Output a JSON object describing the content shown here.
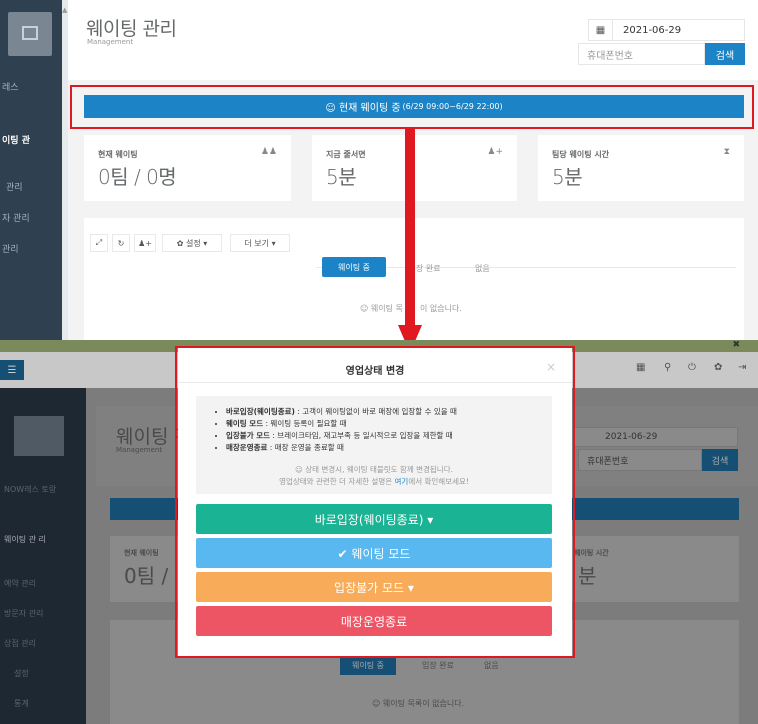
{
  "header": {
    "title": "웨이팅 관리",
    "subtitle": "Management",
    "date": "2021-06-29",
    "phone_placeholder": "휴대폰번호",
    "search_label": "검색"
  },
  "sidebar": {
    "items": [
      "NOW레스 토랑",
      "웨이팅 관리",
      "예약 관리",
      "방문자 관리",
      "상점 관리",
      "설정",
      "통계"
    ],
    "top_items": [
      "레스",
      "이팅 관",
      "관리",
      "자 관리",
      "관리"
    ]
  },
  "status_bar": {
    "label": "☺ 현재 웨이팅 중",
    "range": "(6/29 09:00~6/29 22:00)"
  },
  "stats": [
    {
      "label": "현재 웨이팅",
      "value": "0팀 / 0명",
      "icon": "group-icon"
    },
    {
      "label": "지금 줄서면",
      "value": "5분",
      "icon": "user-add-icon"
    },
    {
      "label": "팀당 웨이팅 시간",
      "value": "5분",
      "icon": "hourglass-icon"
    }
  ],
  "toolbar": {
    "settings_label": "✿ 설정 ▾",
    "more_label": "더 보기 ▾"
  },
  "tabs": [
    "웨이팅 중",
    "입장 완료",
    "없음"
  ],
  "empty_message": "☺ 웨이팅 목록이 없습니다.",
  "bottom_stats": [
    {
      "label": "현재 웨이팅",
      "value": "0팀 /"
    },
    {
      "label": "웨이팅 시간",
      "value": "분"
    }
  ],
  "bottom_tabs": [
    "웨이팅 중",
    "입장 완료",
    "없음"
  ],
  "bottom_empty": "☺ 웨이팅 목록이 없습니다.",
  "top_partial_tabs": [
    "장 완료"
  ],
  "top_partial_empty": "☺ 웨이팅 목",
  "top_partial_empty_tail": "이 없습니다.",
  "bottom_sidebar_labels": [
    "NOW레스 토랑",
    "웨이팅 관 리",
    "예약 관리",
    "방문자 관리",
    "상점 관리",
    "설정",
    "통계"
  ],
  "modal": {
    "title": "영업상태 변경",
    "close": "×",
    "bullets": [
      {
        "bold": "바로입장(웨이팅종료)",
        "text": " : 고객이 웨이팅없이 바로 매장에 입장할 수 있을 때"
      },
      {
        "bold": "웨이팅 모드",
        "text": " : 웨이팅 등록이 필요할 때"
      },
      {
        "bold": "입장불가 모드",
        "text": " : 브레이크타임, 재고부족 등 일시적으로 입장을 제한할 때"
      },
      {
        "bold": "매장운영종료",
        "text": " : 매장 운영을 종료할 때"
      }
    ],
    "note1": "☺ 상태 변경시, 웨이팅 태블릿도 함께 변경됩니다.",
    "note2_pre": "영업상태와 관련한 더 자세한 설명은 ",
    "note2_link": "여기",
    "note2_post": "에서 확인해보세요!",
    "buttons": [
      {
        "label": "바로입장(웨이팅종료) ▾",
        "color": "#1ab394"
      },
      {
        "label": "✔ 웨이팅 모드",
        "color": "#5ab8f0"
      },
      {
        "label": "입장불가 모드 ▾",
        "color": "#f8ac59"
      },
      {
        "label": "매장운영종료",
        "color": "#ed5565"
      }
    ]
  },
  "colors": {
    "primary": "#1c84c6",
    "highlight": "#e0181f",
    "sidebar": "#2f4050"
  }
}
